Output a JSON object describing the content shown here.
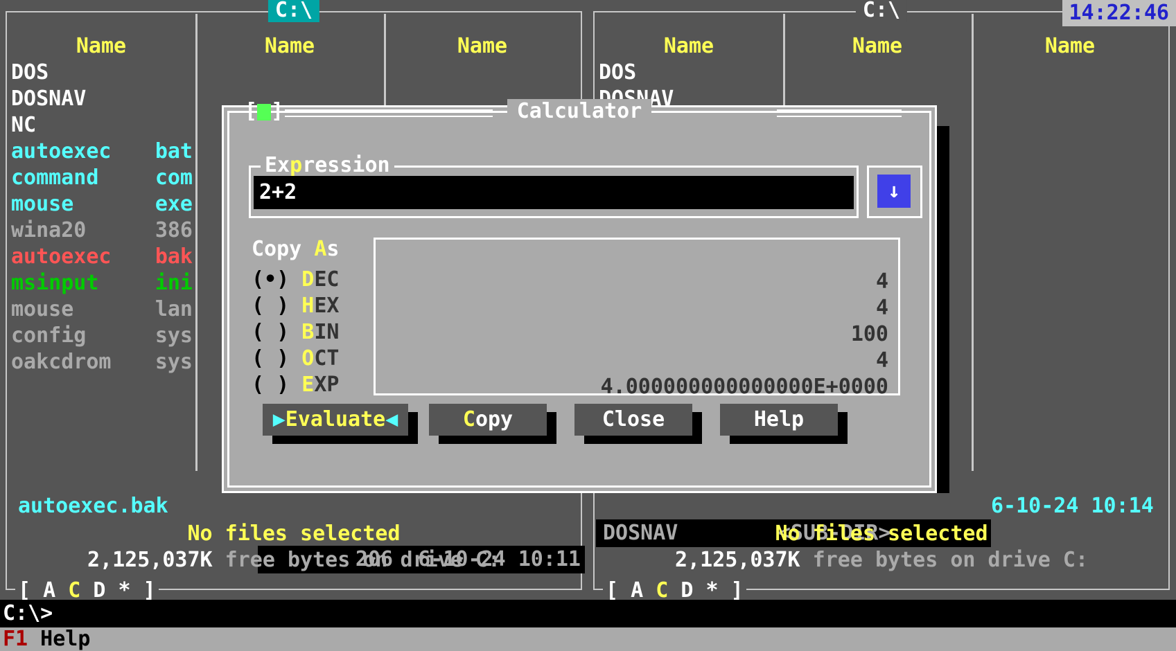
{
  "clock": "14:22:46",
  "left_panel": {
    "title": "C:\\",
    "columns": [
      "Name",
      "Name",
      "Name"
    ],
    "files": [
      {
        "name": "DOS",
        "ext": "",
        "color": "c-white"
      },
      {
        "name": "DOSNAV",
        "ext": "",
        "color": "c-white"
      },
      {
        "name": "NC",
        "ext": "",
        "color": "c-white"
      },
      {
        "name": "autoexec",
        "ext": "bat",
        "color": "c-cyan"
      },
      {
        "name": "command",
        "ext": "com",
        "color": "c-cyan"
      },
      {
        "name": "mouse",
        "ext": "exe",
        "color": "c-cyan"
      },
      {
        "name": "wina20",
        "ext": "386",
        "color": "c-gray"
      },
      {
        "name": "autoexec",
        "ext": "bak",
        "color": "c-red"
      },
      {
        "name": "msinput",
        "ext": "ini",
        "color": "c-green"
      },
      {
        "name": "mouse",
        "ext": "lan",
        "color": "c-gray"
      },
      {
        "name": "config",
        "ext": "sys",
        "color": "c-gray"
      },
      {
        "name": "oakcdrom",
        "ext": "sys",
        "color": "c-gray"
      }
    ],
    "selected_file": "autoexec.bak",
    "selected_size": "206",
    "selected_date": "6-10-24",
    "selected_time": "10:11",
    "no_files_selected": "No files selected",
    "free_amount": "2,125,037K",
    "free_text": "free bytes on drive C:",
    "drive_bar_prefix": "[ A ",
    "drive_bar_current": "C",
    "drive_bar_suffix": " D * ]"
  },
  "right_panel": {
    "title": "C:\\",
    "columns": [
      "Name",
      "Name",
      "Name"
    ],
    "files": [
      {
        "name": "DOS",
        "ext": "",
        "color": "c-white"
      },
      {
        "name": "DOSNAV",
        "ext": "",
        "color": "c-white"
      }
    ],
    "selected_file": "DOSNAV",
    "selected_size": "<SUB-DIR>",
    "selected_date": "6-10-24",
    "selected_time": "10:14",
    "no_files_selected": "No files selected",
    "free_amount": "2,125,037K",
    "free_text": "free bytes on drive C:",
    "drive_bar_prefix": "[ A ",
    "drive_bar_current": "C",
    "drive_bar_suffix": " D * ]"
  },
  "command_line": "C:\\>",
  "function_bar": {
    "key": "F1",
    "label": " Help"
  },
  "calculator": {
    "title": "Calculator",
    "close_box_left": "[",
    "close_box_right": "]",
    "expression_legend_a": "Ex",
    "expression_legend_hot": "p",
    "expression_legend_b": "ression",
    "expression_value": "2+2",
    "history_arrow": "↓",
    "copy_as_label_a": "Copy ",
    "copy_as_label_hot": "A",
    "copy_as_label_b": "s",
    "radios": [
      {
        "marker": "(•)",
        "hot": "D",
        "rest": "EC",
        "selected": true,
        "value": "4"
      },
      {
        "marker": "( )",
        "hot": "H",
        "rest": "EX",
        "selected": false,
        "value": "4"
      },
      {
        "marker": "( )",
        "hot": "B",
        "rest": "IN",
        "selected": false,
        "value": "100"
      },
      {
        "marker": "( )",
        "hot": "O",
        "rest": "CT",
        "selected": false,
        "value": "4"
      },
      {
        "marker": "( )",
        "hot": "E",
        "rest": "XP",
        "selected": false,
        "value": "4.000000000000000E+0000"
      }
    ],
    "buttons": [
      {
        "name": "evaluate",
        "arrow_left": "▶",
        "hot": "E",
        "rest": "valuate",
        "arrow_right": "◀",
        "default": true
      },
      {
        "name": "copy",
        "arrow_left": "",
        "hot": "C",
        "rest": "opy",
        "arrow_right": "",
        "default": false
      },
      {
        "name": "close",
        "arrow_left": "",
        "hot": "",
        "rest": "Close",
        "arrow_right": "",
        "default": false
      },
      {
        "name": "help",
        "arrow_left": "",
        "hot": "",
        "rest": "Help",
        "arrow_right": "",
        "default": false
      }
    ]
  }
}
